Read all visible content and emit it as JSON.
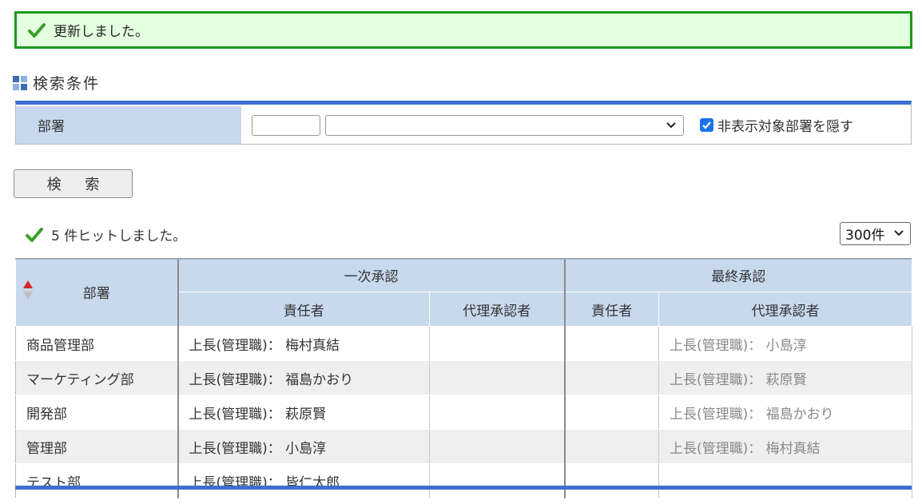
{
  "banner": {
    "message": "更新しました。"
  },
  "search_section": {
    "title": "検索条件"
  },
  "search_form": {
    "dept_label": "部署",
    "dept_code_value": "",
    "dept_select_value": "",
    "hide_label": "非表示対象部署を隠す",
    "hide_checked": true
  },
  "search_button": {
    "label": "検 索"
  },
  "results": {
    "hit_message": "5 件ヒットしました。",
    "per_page": "300件",
    "headers": {
      "dept": "部署",
      "first_approval": "一次承認",
      "final_approval": "最終承認",
      "responsible_1": "責任者",
      "deputy_1": "代理承認者",
      "responsible_2": "責任者",
      "deputy_2": "代理承認者"
    },
    "rows": [
      {
        "dept": "商品管理部",
        "r1": "上長(管理職)： 梅村真結",
        "d1": "",
        "r2": "",
        "d2": "上長(管理職)： 小島淳"
      },
      {
        "dept": "マーケティング部",
        "r1": "上長(管理職)： 福島かおり",
        "d1": "",
        "r2": "",
        "d2": "上長(管理職)： 萩原賢"
      },
      {
        "dept": "開発部",
        "r1": "上長(管理職)： 萩原賢",
        "d1": "",
        "r2": "",
        "d2": "上長(管理職)： 福島かおり"
      },
      {
        "dept": "管理部",
        "r1": "上長(管理職)： 小島淳",
        "d1": "",
        "r2": "",
        "d2": "上長(管理職)： 梅村真結"
      },
      {
        "dept": "テスト部",
        "r1": "上長(管理職)： 皆仁太郎",
        "d1": "",
        "r2": "",
        "d2": ""
      }
    ]
  },
  "colors": {
    "accent": "#3c6fd0",
    "header_bg": "#c8d9ee",
    "success_border": "#1a9a1a",
    "success_bg": "#e3ffe0"
  }
}
